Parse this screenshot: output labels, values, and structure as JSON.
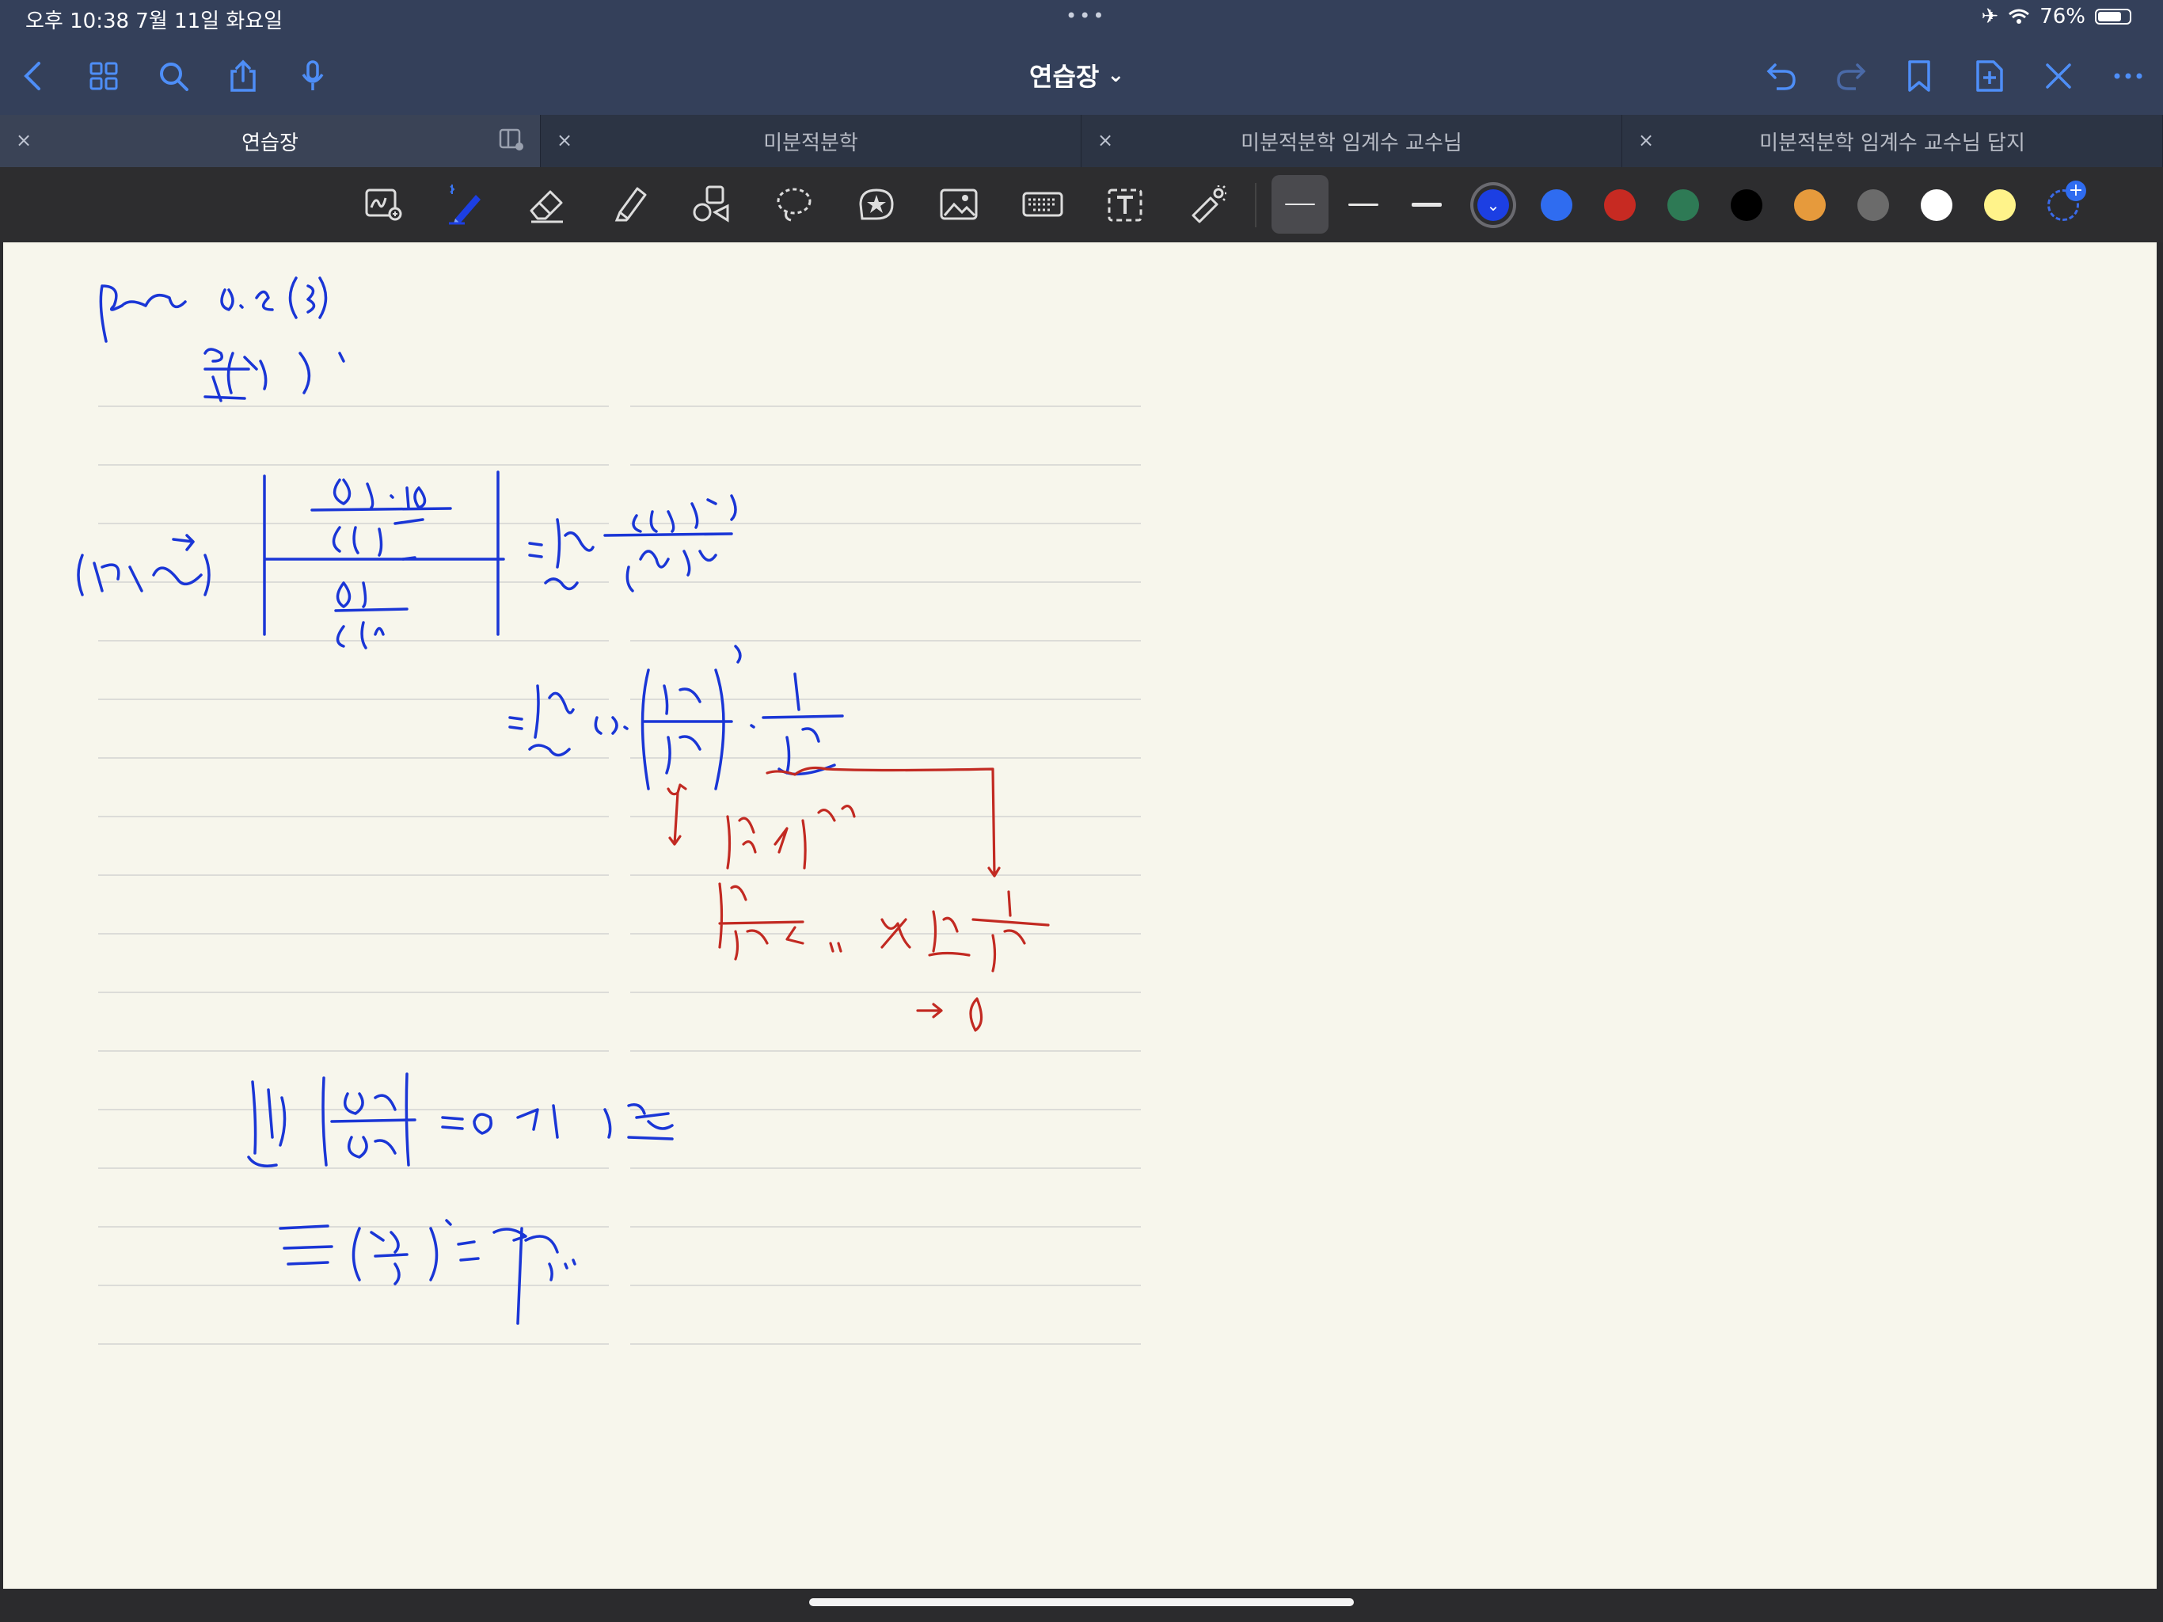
{
  "status": {
    "time": "오후 10:38   7월 11일 화요일",
    "dots": "•••",
    "battery_text": "76%",
    "battery_level": 0.76
  },
  "nav": {
    "document_title": "연습장",
    "title_chevron": "⌄"
  },
  "tabs": [
    {
      "label": "연습장",
      "active": true
    },
    {
      "label": "미분적분학",
      "active": false
    },
    {
      "label": "미분적분학 임계수 교수님",
      "active": false
    },
    {
      "label": "미분적분학 임계수 교수님 답지",
      "active": false
    }
  ],
  "tab_close_glyph": "×",
  "toolbar": {
    "colors": [
      "#1c3fe3",
      "#2f6cf0",
      "#c72a22",
      "#2e7a55",
      "#000000",
      "#e69a3c",
      "#6b6b6b",
      "#ffffff",
      "#fff38a"
    ],
    "selected_color": "#1c3fe3",
    "selected_color_check": "⌄",
    "add_glyph": "+"
  },
  "ink_colors": {
    "blue": "#1a36d6",
    "red": "#c22a22"
  }
}
